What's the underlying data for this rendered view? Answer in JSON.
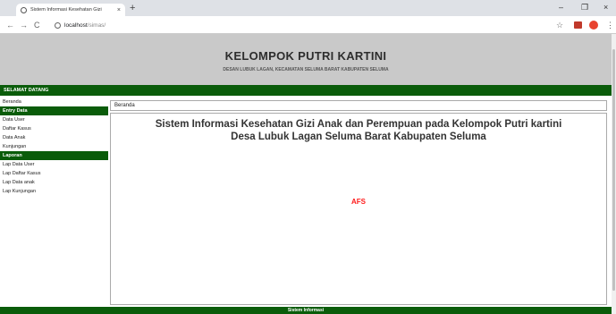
{
  "browser": {
    "tab_title": "Sistem Informasi Kesehatan Gizi",
    "tab_close": "×",
    "new_tab": "+",
    "url_host": "localhost",
    "url_path": "/simas/",
    "controls": {
      "minimize": "–",
      "maximize": "❐",
      "close": "×"
    },
    "nav": {
      "back": "←",
      "forward": "→",
      "reload": "C"
    },
    "star": "☆",
    "menu": "⋮"
  },
  "header": {
    "title": "KELOMPOK PUTRI KARTINI",
    "subtitle": "DESAN LUBUK LAGAN, KECAMATAN SELUMA BARAT KABUPATEN SELUMA"
  },
  "greeting": "SELAMAT DATANG",
  "sidebar": {
    "home": "Beranda",
    "entry_heading": "Entry Data",
    "entry_items": [
      "Data User",
      "Daftar Kasus",
      "Data Anak",
      "Kunjungan"
    ],
    "report_heading": "Laporan",
    "report_items": [
      "Lap Data User",
      "Lap Daftar Kasus",
      "Lap Data anak",
      "Lap Kunjungan"
    ]
  },
  "breadcrumb": "Beranda",
  "main": {
    "title_line1": "Sistem Informasi Kesehatan Gizi Anak dan Perempuan pada Kelompok Putri kartini",
    "title_line2": "Desa Lubuk Lagan Seluma Barat Kabupaten Seluma",
    "afs": "AFS"
  },
  "footer": "Sistem Informasi",
  "colors": {
    "green": "#0a5c0a",
    "header_gray": "#c9c9c9",
    "afs_red": "#ff1a1a"
  }
}
